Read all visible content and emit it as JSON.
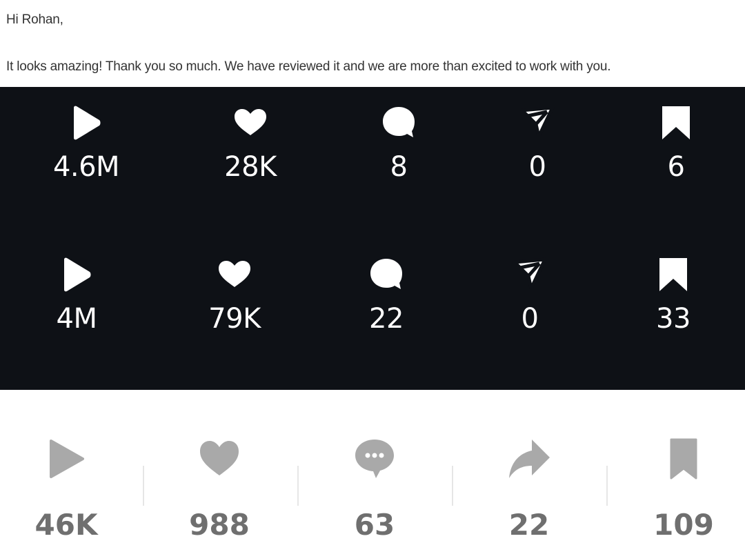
{
  "email": {
    "greeting": "Hi Rohan,",
    "message": "It looks amazing! Thank you so much. We have reviewed it and we are more than excited to work with you."
  },
  "dark_stats": {
    "row1": [
      {
        "icon": "play-icon",
        "value": "4.6M"
      },
      {
        "icon": "heart-icon",
        "value": "28K"
      },
      {
        "icon": "comment-icon",
        "value": "8"
      },
      {
        "icon": "send-icon",
        "value": "0"
      },
      {
        "icon": "bookmark-icon",
        "value": "6"
      }
    ],
    "row2": [
      {
        "icon": "play-icon",
        "value": "4M"
      },
      {
        "icon": "heart-icon",
        "value": "79K"
      },
      {
        "icon": "comment-icon",
        "value": "22"
      },
      {
        "icon": "send-icon",
        "value": "0"
      },
      {
        "icon": "bookmark-icon",
        "value": "33"
      }
    ]
  },
  "light_stats": [
    {
      "icon": "play-icon",
      "value": "46K"
    },
    {
      "icon": "heart-icon",
      "value": "988"
    },
    {
      "icon": "comment-icon",
      "value": "63"
    },
    {
      "icon": "share-icon",
      "value": "22"
    },
    {
      "icon": "bookmark-icon",
      "value": "109"
    }
  ],
  "colors": {
    "dark_panel": "#0e1116",
    "dark_text": "#ffffff",
    "light_icon": "#a9a9a9",
    "light_text": "#6f6f6f",
    "email_text": "#333333"
  }
}
